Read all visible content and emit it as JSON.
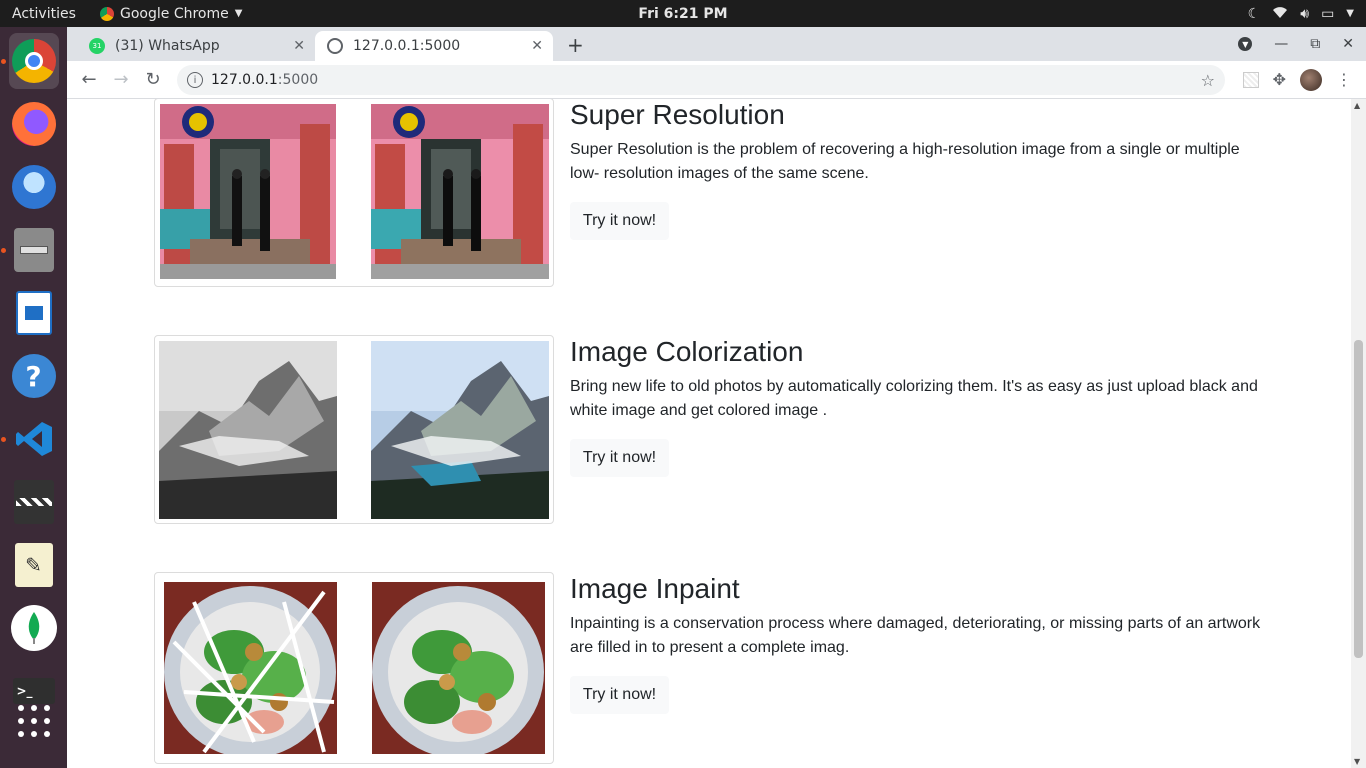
{
  "topbar": {
    "activities": "Activities",
    "app_name": "Google Chrome",
    "clock": "Fri  6:21 PM"
  },
  "dock": {
    "items": [
      {
        "name": "chrome",
        "color": "#e9b94a"
      },
      {
        "name": "firefox",
        "color": "#e66000"
      },
      {
        "name": "thunderbird",
        "color": "#2f76d2"
      },
      {
        "name": "files",
        "color": "#8a8a8a"
      },
      {
        "name": "libreoffice-writer",
        "color": "#1f6fc5"
      },
      {
        "name": "help",
        "color": "#3b87d4"
      },
      {
        "name": "vscode",
        "color": "#1f88d8"
      },
      {
        "name": "video-editor",
        "color": "#333333"
      },
      {
        "name": "text-editor",
        "color": "#f5f0d0"
      },
      {
        "name": "mongodb",
        "color": "#ffffff"
      },
      {
        "name": "terminal",
        "color": "#2f2f2f"
      }
    ]
  },
  "browser": {
    "tabs": [
      {
        "label": "(31) WhatsApp",
        "favicon_color": "#25d366",
        "badge": "31"
      },
      {
        "label": "127.0.0.1:5000",
        "favicon_color": "#5f6368"
      }
    ],
    "address": {
      "host": "127.0.0.1",
      "port": ":5000"
    }
  },
  "page": {
    "sections": [
      {
        "title": "Super Resolution",
        "description": "Super Resolution is the problem of recovering a high-resolution image from a single or multiple low- resolution images of the same scene.",
        "button": "Try it now!"
      },
      {
        "title": "Image Colorization",
        "description": "Bring new life to old photos by automatically colorizing them. It's as easy as just upload black and white image and get colored image .",
        "button": "Try it now!"
      },
      {
        "title": "Image Inpaint",
        "description": "Inpainting is a conservation process where damaged, deteriorating, or missing parts of an artwork are filled in to present a complete imag.",
        "button": "Try it now!"
      }
    ]
  }
}
